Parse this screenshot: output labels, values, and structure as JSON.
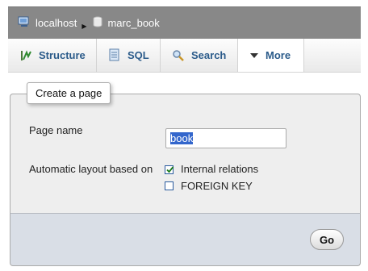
{
  "breadcrumb": {
    "server": {
      "label": "localhost",
      "icon": "server-icon"
    },
    "database": {
      "label": "marc_book",
      "icon": "database-icon"
    }
  },
  "tabs": [
    {
      "label": "Structure",
      "icon": "structure-icon"
    },
    {
      "label": "SQL",
      "icon": "sql-icon"
    },
    {
      "label": "Search",
      "icon": "search-icon"
    },
    {
      "label": "More",
      "icon": "chevron-down-icon",
      "active": true
    }
  ],
  "form": {
    "legend": "Create a page",
    "page_name_label": "Page name",
    "page_name_value": "book",
    "layout_label": "Automatic layout based on",
    "options": [
      {
        "label": "Internal relations",
        "checked": true
      },
      {
        "label": "FOREIGN KEY",
        "checked": false
      }
    ],
    "submit_label": "Go"
  },
  "colors": {
    "breadcrumb_bg": "#888888",
    "tab_text": "#2b5b8a",
    "panel_bg": "#eeeeee",
    "footer_bg": "#d9dee6",
    "selection": "#3366cc"
  }
}
